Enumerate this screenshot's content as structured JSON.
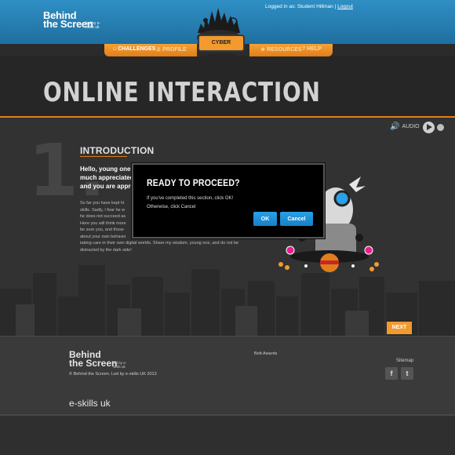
{
  "header": {
    "logo": {
      "line1": "Behind",
      "line2": "the Screen",
      "tagline": "led by e-skills uk"
    },
    "login_prefix": "Logged in as:",
    "user": "Student Hillman",
    "separator": "|",
    "logout": "Logout",
    "badge": "CYBER SECURITY"
  },
  "nav": {
    "challenges": "CHALLENGES",
    "profile": "PROFILE",
    "resources": "RESOURCES",
    "help": "HELP"
  },
  "page": {
    "title": "ONLINE INTERACTION"
  },
  "audio": {
    "label": "AUDIO"
  },
  "section": {
    "number": "1.",
    "heading": "INTRODUCTION",
    "intro_lines": [
      "Hello, young one,",
      "much appreciated",
      "and you are appro"
    ],
    "body_lines": [
      "So far you have kept hi",
      "skills. Sadly, I fear he w",
      "he does not succeed as",
      "Here you will think more",
      "be sure you, and those",
      "about your own behavio",
      "taking care in their own digital worlds.  Share my wisdom, young one, and do not be",
      "distracted by the dark side!"
    ],
    "next": "NEXT"
  },
  "modal": {
    "title": "READY TO PROCEED?",
    "line1": "If you've completed this section, click OK!",
    "line2": "Otherwise, click Cancel",
    "ok": "OK",
    "cancel": "Cancel"
  },
  "footer": {
    "logo": {
      "line1": "Behind",
      "line2": "the Screen",
      "tagline": "led by e-skills uk"
    },
    "copyright": "© Behind the Screen. Led by e-skills UK 2013",
    "bett": "Bett Awards",
    "sitemap": "Sitemap",
    "facebook_icon": "f",
    "twitter_icon": "t",
    "eskills": "e-skills uk"
  },
  "colors": {
    "accent": "#f29a2e",
    "header": "#2382b4",
    "button": "#1e90d6"
  }
}
